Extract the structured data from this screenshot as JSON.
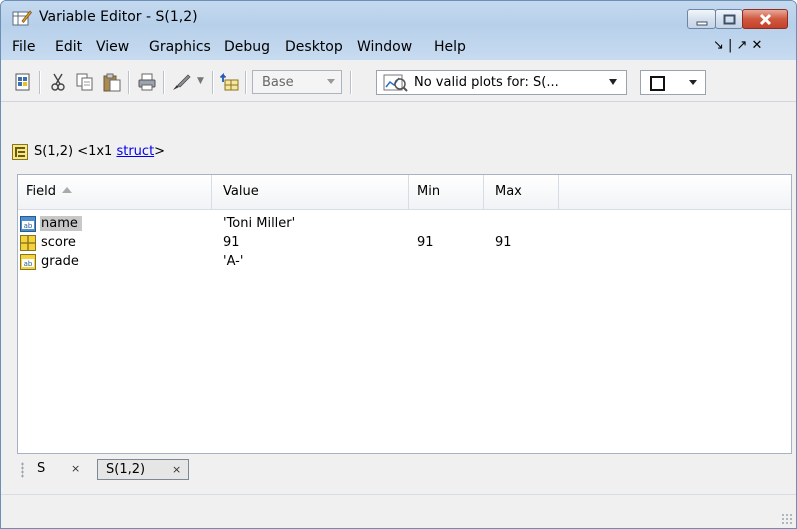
{
  "window": {
    "title": "Variable Editor - S(1,2)"
  },
  "menu": {
    "items": [
      "File",
      "Edit",
      "View",
      "Graphics",
      "Debug",
      "Desktop",
      "Window",
      "Help"
    ],
    "dock_icons": "↘ | ↗ ✕"
  },
  "toolbar": {
    "base_combo": "Base",
    "plot_combo": "No valid plots for: S(..."
  },
  "breadcrumb": {
    "prefix": "S(1,2) <1x1 ",
    "link": "struct",
    "suffix": ">"
  },
  "table": {
    "headers": {
      "field": "Field",
      "value": "Value",
      "min": "Min",
      "max": "Max"
    },
    "rows": [
      {
        "field": "name",
        "value": "'Toni Miller'",
        "min": "",
        "max": "",
        "icon": "char-icon"
      },
      {
        "field": "score",
        "value": "91",
        "min": "91",
        "max": "91",
        "icon": "numeric-array-icon"
      },
      {
        "field": "grade",
        "value": "'A-'",
        "min": "",
        "max": "",
        "icon": "char-icon"
      }
    ]
  },
  "tabs": [
    {
      "label": "S",
      "close": "×"
    },
    {
      "label": "S(1,2)",
      "close": "×"
    }
  ],
  "colors": {
    "title_bar": "#c4d9ef",
    "selection": "#c8c8c8",
    "link": "#0000ee",
    "close_button": "#c4412a"
  }
}
